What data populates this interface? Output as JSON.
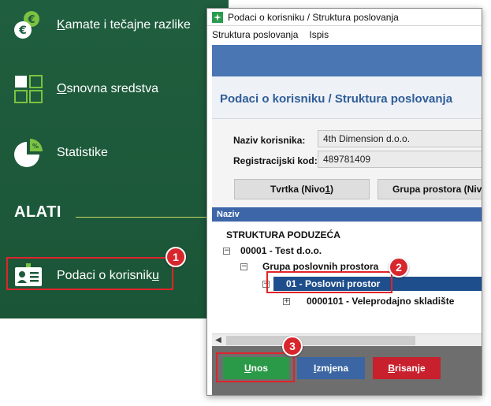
{
  "sidebar": {
    "items": [
      {
        "label_first": "K",
        "label_rest": "amate i tečajne razlike",
        "icon": "euro-coins-icon"
      },
      {
        "label_first": "O",
        "label_rest": "snovna sredstva",
        "icon": "grid-squares-icon"
      },
      {
        "label": "Statistike",
        "icon": "pie-chart-icon"
      }
    ],
    "section_title": "ALATI",
    "tools_item": {
      "label_main": "Podaci o korisnik",
      "label_last": "u",
      "icon": "id-card-icon"
    }
  },
  "window": {
    "title": "Podaci o korisniku /  Struktura poslovanja",
    "menu": [
      "Struktura poslovanja",
      "Ispis"
    ],
    "heading": "Podaci o korisniku /  Struktura poslovanja",
    "form": {
      "naziv_label": "Naziv korisnika:",
      "naziv_value": "4th Dimension d.o.o.",
      "reg_label": "Registracijski kod:",
      "reg_value": "489781409"
    },
    "tabs": {
      "tab1_prefix": "Tvrtka (Nivo ",
      "tab1_num": "1",
      "tab1_suffix": ")",
      "tab2": "Grupa prostora (Niv"
    },
    "grid_header": "Naziv",
    "tree": {
      "root": "STRUKTURA PODUZEĆA",
      "level1": "00001 - Test d.o.o.",
      "level2": "Grupa poslovnih prostora",
      "level3_selected": "01 - Poslovni prostor",
      "level4": "0000101 - Veleprodajno skladište",
      "expanded_glyph": "−",
      "collapsed_glyph": "+"
    },
    "buttons": {
      "unos_first": "U",
      "unos_rest": "nos",
      "izmjena_first": "I",
      "izmjena_rest": "zmjena",
      "brisanje_first": "B",
      "brisanje_rest": "risanje"
    }
  },
  "callouts": [
    "1",
    "2",
    "3"
  ],
  "colors": {
    "sidebar_bg": "#1d5a3b",
    "accent_green": "#2b9a48",
    "callout_red": "#d8262d",
    "header_blue": "#3d66a8",
    "delete_red": "#c8202d"
  }
}
